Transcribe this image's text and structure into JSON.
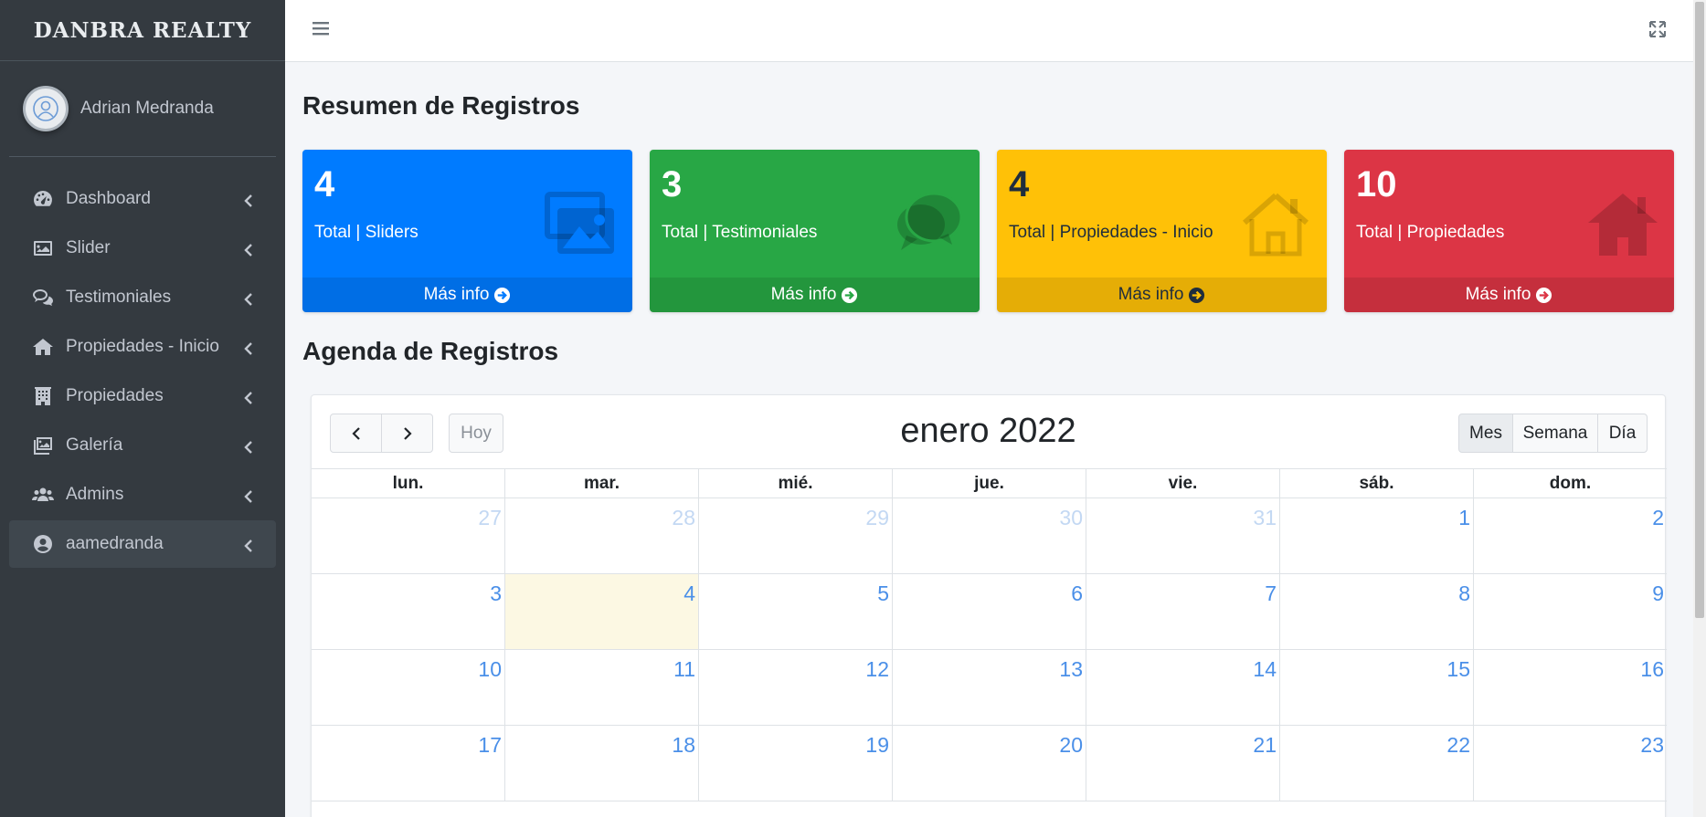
{
  "sidebar": {
    "brand": "DANBRA REALTY",
    "user": "Adrian Medranda",
    "items": [
      {
        "label": "Dashboard",
        "icon": "dashboard-icon"
      },
      {
        "label": "Slider",
        "icon": "image-icon"
      },
      {
        "label": "Testimoniales",
        "icon": "comments-icon"
      },
      {
        "label": "Propiedades - Inicio",
        "icon": "home-icon"
      },
      {
        "label": "Propiedades",
        "icon": "building-icon"
      },
      {
        "label": "Galería",
        "icon": "gallery-icon"
      },
      {
        "label": "Admins",
        "icon": "users-icon"
      },
      {
        "label": "aamedranda",
        "icon": "user-circle-icon"
      }
    ]
  },
  "summary": {
    "title": "Resumen de Registros",
    "boxes": [
      {
        "value": "4",
        "label": "Total | Sliders",
        "more": "Más info",
        "color": "#007bff"
      },
      {
        "value": "3",
        "label": "Total | Testimoniales",
        "more": "Más info",
        "color": "#28a745"
      },
      {
        "value": "4",
        "label": "Total | Propiedades - Inicio",
        "more": "Más info",
        "color": "#ffc107"
      },
      {
        "value": "10",
        "label": "Total | Propiedades",
        "more": "Más info",
        "color": "#dc3545"
      }
    ]
  },
  "agenda": {
    "title": "Agenda de Registros",
    "today_btn": "Hoy",
    "month_title": "enero 2022",
    "views": [
      "Mes",
      "Semana",
      "Día"
    ],
    "weekdays": [
      "lun.",
      "mar.",
      "mié.",
      "jue.",
      "vie.",
      "sáb.",
      "dom."
    ],
    "weeks": [
      [
        "27",
        "28",
        "29",
        "30",
        "31",
        "1",
        "2"
      ],
      [
        "3",
        "4",
        "5",
        "6",
        "7",
        "8",
        "9"
      ],
      [
        "10",
        "11",
        "12",
        "13",
        "14",
        "15",
        "16"
      ],
      [
        "17",
        "18",
        "19",
        "20",
        "21",
        "22",
        "23"
      ]
    ]
  }
}
